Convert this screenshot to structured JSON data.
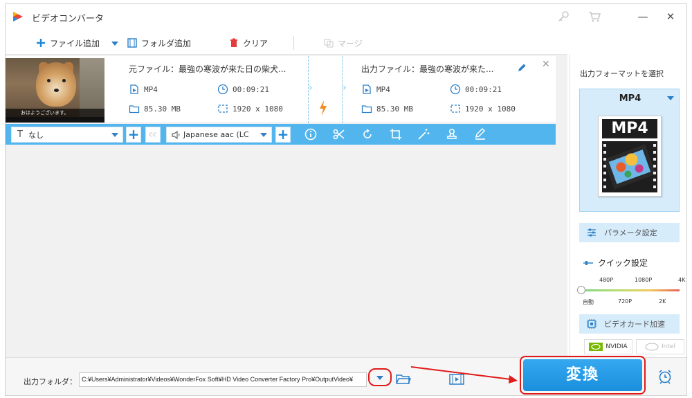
{
  "app": {
    "title": "ビデオコンバータ"
  },
  "window_controls": {
    "minimize": "—",
    "close": "✕"
  },
  "toolbar": {
    "add_file": "ファイル追加",
    "add_folder": "フォルダ追加",
    "clear": "クリア",
    "merge": "マージ"
  },
  "file": {
    "source_label": "元ファイル：",
    "source_name": "最強の寒波が来た日の柴犬...",
    "source": {
      "format": "MP4",
      "duration": "00:09:21",
      "size": "85.30 MB",
      "resolution": "1920 x 1080"
    },
    "output_label": "出力ファイル：",
    "output_name": "最強の寒波が来た...",
    "output": {
      "format": "MP4",
      "duration": "00:09:21",
      "size": "85.30 MB",
      "resolution": "1920 x 1080"
    },
    "thumbnail_caption": "おはようございます。",
    "close": "✕"
  },
  "editbar": {
    "subtitle_value": "なし",
    "cc_label": "cc",
    "audio_value": "Japanese aac (LC",
    "plus": "+"
  },
  "right_panel": {
    "title": "出力フォーマットを選択",
    "format": "MP4",
    "format_icon_label": "MP4",
    "param_settings": "パラメータ設定",
    "quick_settings": "クイック設定",
    "quality_top": [
      "480P",
      "1080P",
      "4K"
    ],
    "quality_bottom": [
      "自動",
      "720P",
      "2K"
    ],
    "quality_level": 0,
    "gpu_accel": "ビデオカード加速",
    "nvidia": "NVIDIA",
    "intel": "Intel"
  },
  "bottom": {
    "output_folder_label": "出力フォルダ：",
    "output_path": "C:¥Users¥Administrator¥Videos¥WonderFox Soft¥HD Video Converter Factory Pro¥OutputVideo¥",
    "convert": "変換"
  },
  "colors": {
    "accent": "#52b5ee",
    "convert": "#1a8fdc",
    "highlight": "#e01919"
  }
}
